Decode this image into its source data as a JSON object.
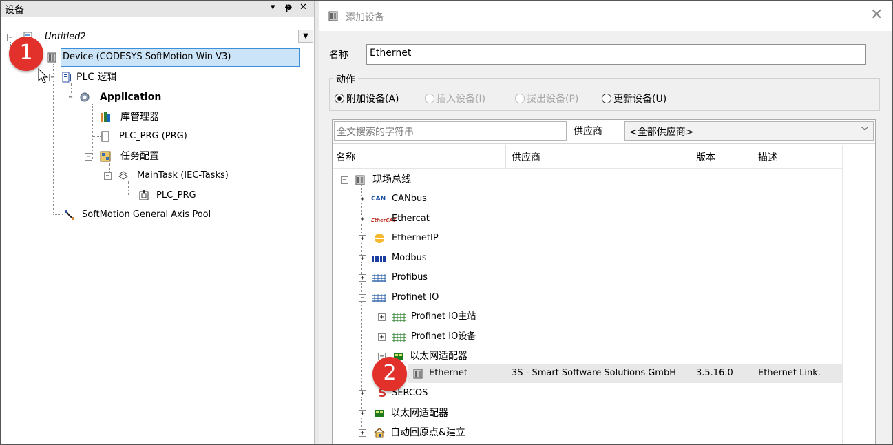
{
  "left_panel": {
    "title": "设备",
    "controls": {
      "pin": "▾",
      "dock": "ᵽ",
      "close": "✕"
    },
    "scroll_btn": "▼",
    "tree": [
      {
        "label": "Untitled2",
        "icon": "project-icon"
      },
      {
        "label": "Device (CODESYS SoftMotion Win V3)",
        "icon": "device-icon",
        "selected": true
      },
      {
        "label": "PLC 逻辑",
        "icon": "plc-logic-icon"
      },
      {
        "label": "Application",
        "icon": "gear-icon"
      },
      {
        "label": "库管理器",
        "icon": "library-icon"
      },
      {
        "label": "PLC_PRG (PRG)",
        "icon": "document-icon"
      },
      {
        "label": "任务配置",
        "icon": "task-config-icon"
      },
      {
        "label": "MainTask (IEC-Tasks)",
        "icon": "task-icon"
      },
      {
        "label": "PLC_PRG",
        "icon": "program-call-icon"
      },
      {
        "label": "SoftMotion General Axis Pool",
        "icon": "axis-pool-icon"
      }
    ]
  },
  "badges": {
    "one": "1",
    "two": "2"
  },
  "dialog": {
    "title": "添加设备",
    "close": "✕",
    "name_label": "名称",
    "name_value": "Ethernet",
    "action_label": "动作",
    "radios": [
      {
        "label": "附加设备(A)",
        "checked": true,
        "enabled": true
      },
      {
        "label": "插入设备(I)",
        "checked": false,
        "enabled": false
      },
      {
        "label": "拔出设备(P)",
        "checked": false,
        "enabled": false
      },
      {
        "label": "更新设备(U)",
        "checked": false,
        "enabled": true
      }
    ],
    "search_placeholder": "全文搜索的字符串",
    "vendor_label": "供应商",
    "vendor_value": "<全部供应商>",
    "columns": [
      "名称",
      "供应商",
      "版本",
      "描述"
    ],
    "list": [
      {
        "label": "现场总线"
      },
      {
        "label": "CANbus"
      },
      {
        "label": "Ethercat"
      },
      {
        "label": "EthernetIP"
      },
      {
        "label": "Modbus"
      },
      {
        "label": "Profibus"
      },
      {
        "label": "Profinet IO"
      },
      {
        "label": "Profinet IO主站"
      },
      {
        "label": "Profinet IO设备"
      },
      {
        "label": "以太网适配器"
      },
      {
        "label": "Ethernet",
        "vendor": "3S - Smart Software Solutions GmbH",
        "version": "3.5.16.0",
        "description": "Ethernet Link."
      },
      {
        "label": "SERCOS"
      },
      {
        "label": "以太网适配器"
      },
      {
        "label": "自动回原点&建立"
      }
    ],
    "icon_texts": {
      "can": "CAN",
      "ethercat": "EtherCAT",
      "sercos": "S"
    }
  }
}
